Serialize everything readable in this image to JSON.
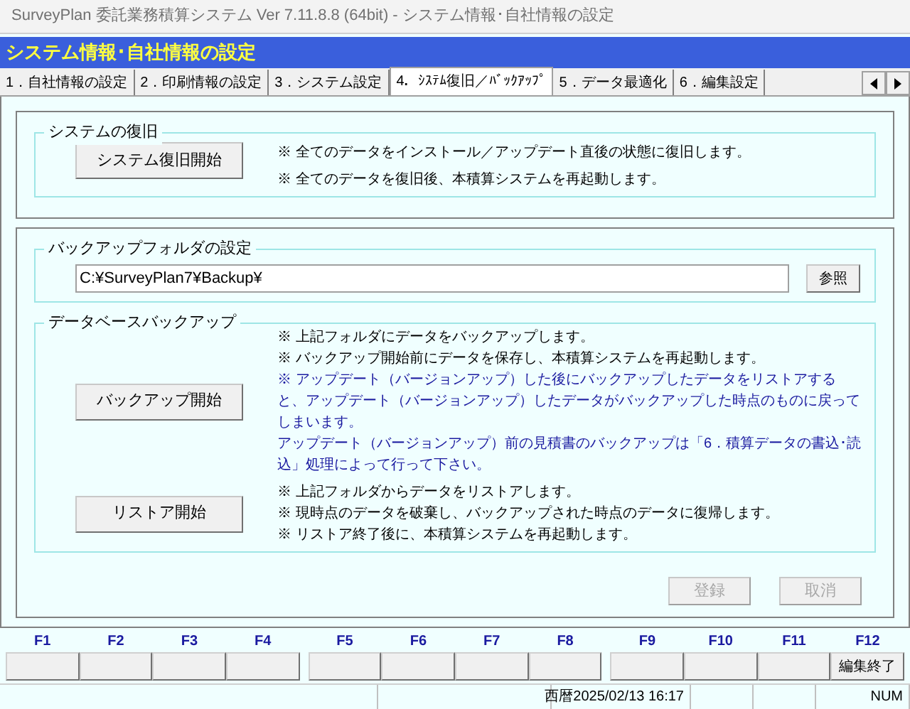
{
  "window": {
    "title": "SurveyPlan 委託業務積算システム Ver 7.11.8.8 (64bit)  - システム情報･自社情報の設定"
  },
  "header": "システム情報･自社情報の設定",
  "tabs": [
    {
      "label": "1．自社情報の設定",
      "selected": false
    },
    {
      "label": "2．印刷情報の設定",
      "selected": false
    },
    {
      "label": "3．システム設定",
      "selected": false
    },
    {
      "label": "4．ｼｽﾃﾑ復旧／ﾊﾞｯｸｱｯﾌﾟ",
      "selected": true
    },
    {
      "label": "5．データ最適化",
      "selected": false
    },
    {
      "label": "6．編集設定",
      "selected": false
    }
  ],
  "restore": {
    "legend": "システムの復旧",
    "button": "システム復旧開始",
    "notes": [
      {
        "text": "※ 全てのデータをインストール／アップデート直後の状態に復旧します。",
        "emphasis": false
      },
      {
        "text": "※ 全てのデータを復旧後、本積算システムを再起動します。",
        "emphasis": false
      }
    ]
  },
  "backup_folder": {
    "legend": "バックアップフォルダの設定",
    "path": "C:¥SurveyPlan7¥Backup¥",
    "browse_button": "参照"
  },
  "db_backup": {
    "legend": "データベースバックアップ",
    "backup_button": "バックアップ開始",
    "backup_notes": [
      {
        "text": "※ 上記フォルダにデータをバックアップします。",
        "emphasis": false
      },
      {
        "text": "※ バックアップ開始前にデータを保存し、本積算システムを再起動します。",
        "emphasis": false
      },
      {
        "text": "※ アップデート（バージョンアップ）した後にバックアップしたデータをリストアすると、アップデート（バージョンアップ）したデータがバックアップした時点のものに戻ってしまいます。",
        "emphasis": true
      },
      {
        "text": "アップデート（バージョンアップ）前の見積書のバックアップは「6．積算データの書込･読込」処理によって行って下さい。",
        "emphasis": true
      }
    ],
    "restore_button": "リストア開始",
    "restore_notes": [
      {
        "text": "※ 上記フォルダからデータをリストアします。",
        "emphasis": false
      },
      {
        "text": "※ 現時点のデータを破棄し、バックアップされた時点のデータに復帰します。",
        "emphasis": false
      },
      {
        "text": "※ リストア終了後に、本積算システムを再起動します。",
        "emphasis": false
      }
    ]
  },
  "actions": [
    {
      "label": "登録",
      "disabled": true
    },
    {
      "label": "取消",
      "disabled": true
    }
  ],
  "function_keys": [
    {
      "key": "F1"
    },
    {
      "key": "F2"
    },
    {
      "key": "F3"
    },
    {
      "key": "F4"
    },
    {
      "key": "F5"
    },
    {
      "key": "F6"
    },
    {
      "key": "F7"
    },
    {
      "key": "F8"
    },
    {
      "key": "F9"
    },
    {
      "key": "F10"
    },
    {
      "key": "F11"
    },
    {
      "key": "F12",
      "label": "編集終了"
    }
  ],
  "status_bar": {
    "date_time": "西暦2025/02/13 16:17",
    "num_lock": "NUM"
  }
}
